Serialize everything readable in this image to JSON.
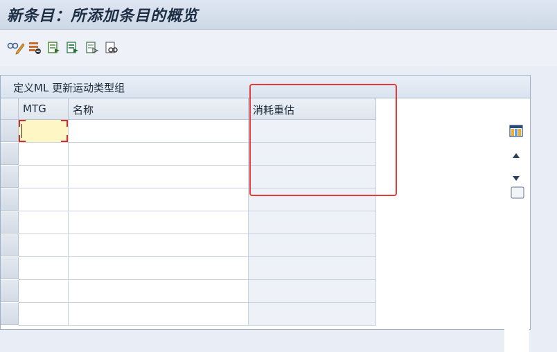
{
  "window": {
    "title": "新条目：所添加条目的概览"
  },
  "toolbar": {
    "buttons": [
      {
        "name": "display-change-icon"
      },
      {
        "name": "delete-icon"
      },
      {
        "name": "copy-entry-icon"
      },
      {
        "name": "select-block-icon"
      },
      {
        "name": "deselect-icon"
      },
      {
        "name": "print-preview-icon"
      }
    ]
  },
  "table": {
    "caption": "定义ML 更新运动类型组",
    "columns": [
      "MTG",
      "名称",
      "消耗重估"
    ],
    "row_count": 9
  },
  "scroll": {
    "icons": [
      "table-settings-icon",
      "scroll-up-icon",
      "scroll-down-icon",
      "scroll-end-icon"
    ]
  },
  "colors": {
    "accent_highlight": "#e53a3a",
    "active_cell": "#fff6c6"
  }
}
